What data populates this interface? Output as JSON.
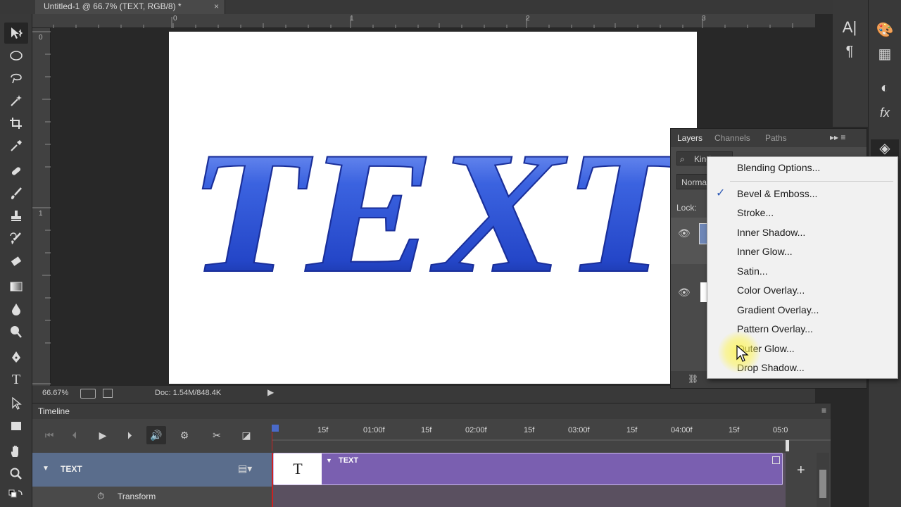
{
  "document_tab": {
    "title": "Untitled-1 @ 66.7% (TEXT, RGB/8) *",
    "close_glyph": "×"
  },
  "rulers": {
    "horizontal": [
      "0",
      "1",
      "2",
      "3"
    ],
    "vertical": [
      "0",
      "1"
    ]
  },
  "canvas": {
    "text": "TEXT",
    "text_color": "#2f56d6"
  },
  "status_bar": {
    "zoom": "66.67%",
    "doc_info": "Doc: 1.54M/848.4K"
  },
  "layers_panel": {
    "tabs": [
      "Layers",
      "Channels",
      "Paths"
    ],
    "kind_label": "Kind",
    "blend_mode": "Normal",
    "lock_label": "Lock:"
  },
  "context_menu": {
    "items": [
      {
        "label": "Blending Options...",
        "checked": false
      },
      {
        "label": "Bevel & Emboss...",
        "checked": true
      },
      {
        "label": "Stroke...",
        "checked": false
      },
      {
        "label": "Inner Shadow...",
        "checked": false
      },
      {
        "label": "Inner Glow...",
        "checked": false
      },
      {
        "label": "Satin...",
        "checked": false
      },
      {
        "label": "Color Overlay...",
        "checked": false
      },
      {
        "label": "Gradient Overlay...",
        "checked": false
      },
      {
        "label": "Pattern Overlay...",
        "checked": false
      },
      {
        "label": "Outer Glow...",
        "checked": false
      },
      {
        "label": "Drop Shadow...",
        "checked": false
      }
    ],
    "check_glyph": "✓"
  },
  "timeline": {
    "panel_title": "Timeline",
    "ticks": [
      "15f",
      "01:00f",
      "15f",
      "02:00f",
      "15f",
      "03:00f",
      "15f",
      "04:00f",
      "15f",
      "05:0"
    ],
    "layer_name": "TEXT",
    "clip_label": "TEXT",
    "clip_thumb": "T",
    "transform_label": "Transform",
    "add_glyph": "+"
  },
  "dock": {
    "icons": [
      "character-icon",
      "paragraph-icon",
      "swatches-icon",
      "grid-icon",
      "adjustments-icon",
      "styles-icon",
      "layers-icon"
    ]
  }
}
